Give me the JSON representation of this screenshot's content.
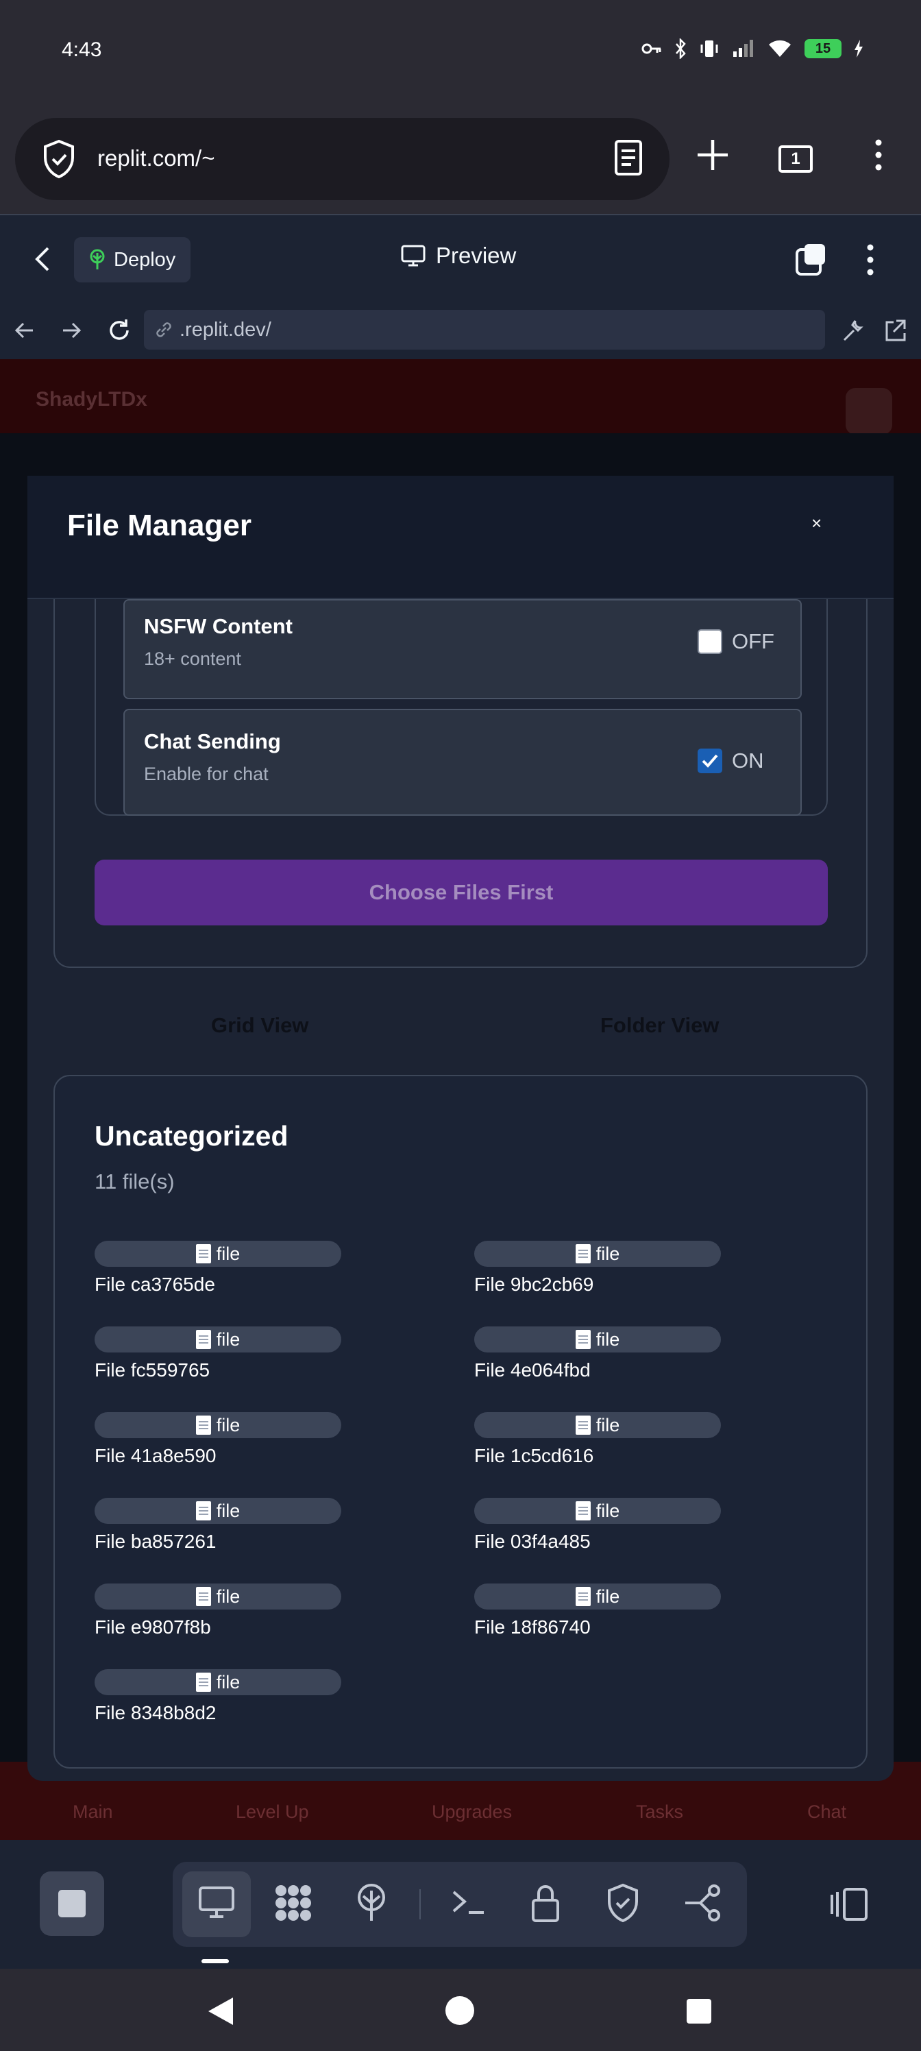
{
  "status": {
    "time": "4:43",
    "battery": "15"
  },
  "browser": {
    "url": "replit.com/~",
    "tab_count": "1"
  },
  "replit": {
    "deploy_label": "Deploy",
    "preview_label": "Preview",
    "web_url": ".replit.dev/"
  },
  "app": {
    "brand": "ShadyLTDx",
    "tabs": [
      "Main",
      "Level Up",
      "Upgrades",
      "Tasks",
      "Chat"
    ]
  },
  "modal": {
    "title": "File Manager",
    "close": "×",
    "settings": [
      {
        "name": "NSFW Content",
        "desc": "18+ content",
        "state": "OFF",
        "checked": false
      },
      {
        "name": "Chat Sending",
        "desc": "Enable for chat",
        "state": "ON",
        "checked": true
      }
    ],
    "choose_button": "Choose Files First",
    "views": {
      "grid": "Grid View",
      "folder": "Folder View"
    },
    "category": {
      "title": "Uncategorized",
      "count": "11 file(s)",
      "chip_label": "file",
      "files": [
        "File ca3765de",
        "File 9bc2cb69",
        "File fc559765",
        "File 4e064fbd",
        "File 41a8e590",
        "File 1c5cd616",
        "File ba857261",
        "File 03f4a485",
        "File e9807f8b",
        "File 18f86740",
        "File 8348b8d2"
      ]
    }
  },
  "colors": {
    "accent_purple": "#5b2c8f",
    "panel": "#1c2333",
    "checkbox_on": "#1a5fb4"
  }
}
